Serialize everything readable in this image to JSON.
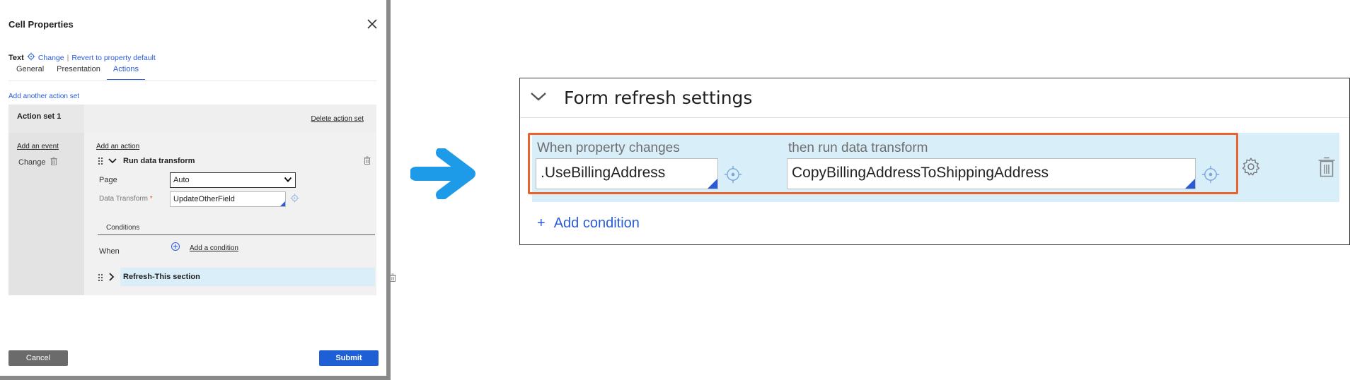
{
  "dialog": {
    "title": "Cell Properties",
    "property_label": "Text",
    "change_link": "Change",
    "separator": "|",
    "revert_link": "Revert to property default",
    "tabs": [
      {
        "label": "General"
      },
      {
        "label": "Presentation"
      },
      {
        "label": "Actions",
        "active": true
      }
    ],
    "add_action_set": "Add another action set",
    "action_set": {
      "title": "Action set 1",
      "delete_label": "Delete action set",
      "add_event": "Add an event",
      "event": "Change",
      "add_action": "Add an action",
      "action_label": "Run data transform",
      "page_label": "Page",
      "page_value": "Auto",
      "data_transform_label": "Data Transform",
      "data_transform_required": "*",
      "data_transform_value": "UpdateOtherField",
      "conditions_label": "Conditions",
      "when_label": "When",
      "add_condition": "Add a condition",
      "refresh_label": "Refresh-This section"
    },
    "cancel_label": "Cancel",
    "submit_label": "Submit"
  },
  "form_refresh": {
    "title": "Form refresh settings",
    "when_property_label": "When property changes",
    "when_property_value": ".UseBillingAddress",
    "then_transform_label": "then run data transform",
    "then_transform_value": "CopyBillingAddressToShippingAddress",
    "add_condition_plus": "+",
    "add_condition": "Add condition"
  },
  "colors": {
    "accent": "#2a5bd7",
    "highlight": "#e8632e",
    "band": "#d8eef9",
    "arrow": "#1e9be8",
    "submit": "#1f5fd6",
    "cancel": "#6b6b6b"
  },
  "icons": [
    "close-icon",
    "target-icon",
    "trash-icon",
    "drag-handle-icon",
    "chevron-down-icon",
    "chevron-right-icon",
    "add-circle-icon",
    "gear-icon",
    "arrow-right-icon"
  ]
}
